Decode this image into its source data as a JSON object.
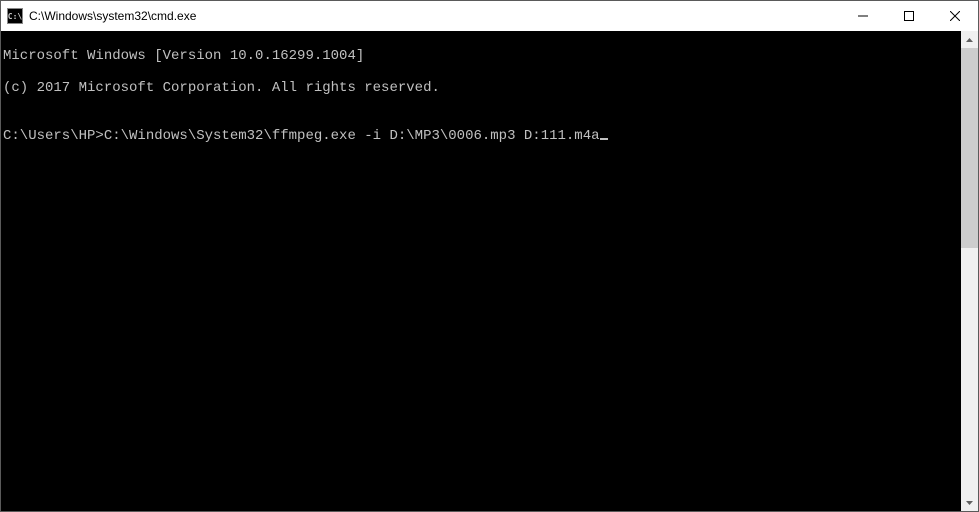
{
  "titlebar": {
    "icon_label": "C:\\",
    "title": "C:\\Windows\\system32\\cmd.exe"
  },
  "console": {
    "lines": [
      "Microsoft Windows [Version 10.0.16299.1004]",
      "(c) 2017 Microsoft Corporation. All rights reserved.",
      "",
      "C:\\Users\\HP>C:\\Windows\\System32\\ffmpeg.exe -i D:\\MP3\\0006.mp3 D:111.m4a"
    ]
  }
}
